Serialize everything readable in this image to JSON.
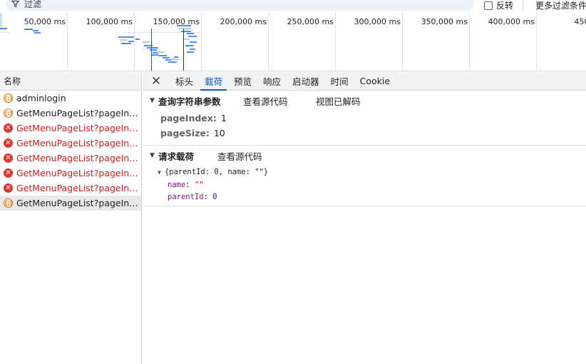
{
  "filter": {
    "placeholder": "过滤",
    "invert_label": "反转",
    "more_filters_label": "更多过滤条件"
  },
  "timeline": {
    "ticks": [
      "50,000 ms",
      "100,000 ms",
      "150,000 ms",
      "200,000 ms",
      "250,000 ms",
      "300,000 ms",
      "350,000 ms",
      "400,000 ms",
      "450,00"
    ]
  },
  "request_list": {
    "header": "名称",
    "rows": [
      {
        "name": "adminlogin",
        "status": "ok",
        "icon": "xhr-icon"
      },
      {
        "name": "GetMenuPageList?pageInde...",
        "status": "ok",
        "icon": "xhr-icon"
      },
      {
        "name": "GetMenuPageList?pageInde...",
        "status": "error",
        "icon": "error-icon"
      },
      {
        "name": "GetMenuPageList?pageInde...",
        "status": "error",
        "icon": "error-icon"
      },
      {
        "name": "GetMenuPageList?pageInde...",
        "status": "error",
        "icon": "error-icon"
      },
      {
        "name": "GetMenuPageList?pageInde...",
        "status": "error",
        "icon": "error-icon"
      },
      {
        "name": "GetMenuPageList?pageInde...",
        "status": "error",
        "icon": "error-icon"
      },
      {
        "name": "GetMenuPageList?pageInde...",
        "status": "ok",
        "icon": "xhr-icon",
        "selected": true
      }
    ]
  },
  "detail": {
    "tabs": [
      "标头",
      "载荷",
      "预览",
      "响应",
      "启动器",
      "时间",
      "Cookie"
    ],
    "active_tab": "载荷",
    "query_section": {
      "title": "查询字符串参数",
      "view_source": "查看源代码",
      "view_decoded": "视图已解码",
      "params": [
        {
          "key": "pageIndex:",
          "value": "1"
        },
        {
          "key": "pageSize:",
          "value": "10"
        }
      ]
    },
    "payload_section": {
      "title": "请求载荷",
      "view_source": "查看源代码",
      "summary": "{parentId: 0, name: \"\"}",
      "props": [
        {
          "key": "name",
          "value": "\"\"",
          "kind": "string"
        },
        {
          "key": "parentId",
          "value": "0",
          "kind": "number"
        }
      ]
    }
  },
  "colors": {
    "accent": "#0b57d0",
    "error": "#c5221f",
    "xhr": "#e8710a"
  }
}
